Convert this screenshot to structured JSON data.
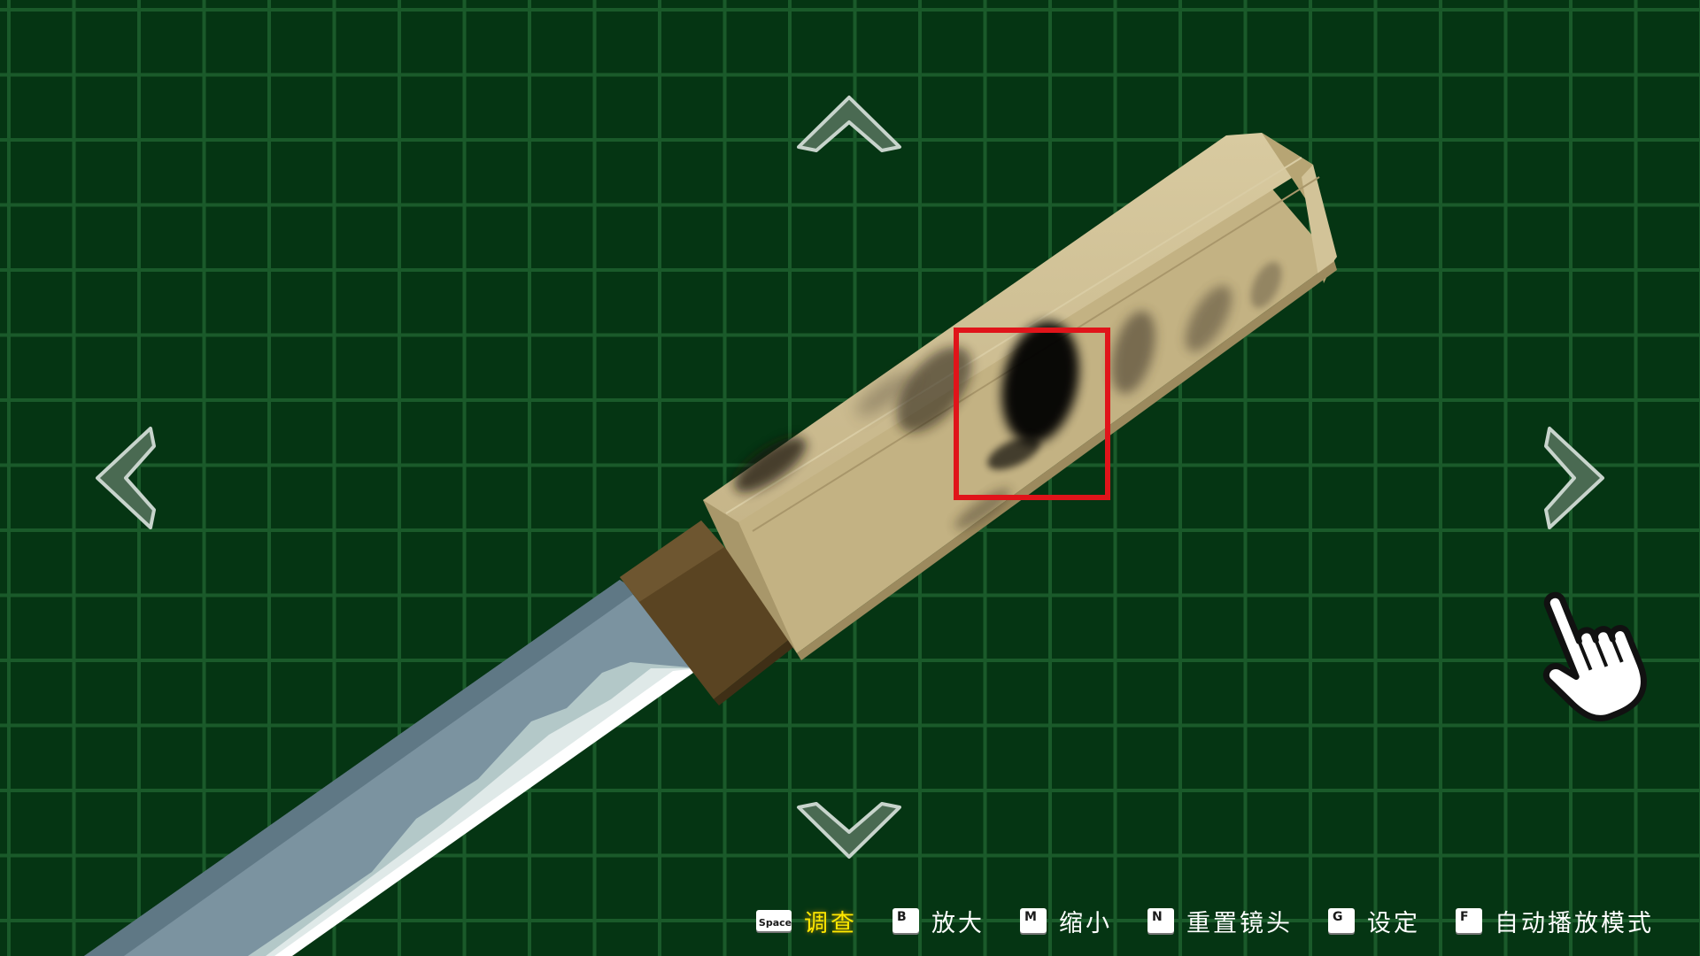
{
  "controls": [
    {
      "key": "Space",
      "label": "调查",
      "active": true
    },
    {
      "key": "B",
      "label": "放大",
      "active": false
    },
    {
      "key": "M",
      "label": "缩小",
      "active": false
    },
    {
      "key": "N",
      "label": "重置镜头",
      "active": false
    },
    {
      "key": "G",
      "label": "设定",
      "active": false
    },
    {
      "key": "F",
      "label": "自动播放模式",
      "active": false
    }
  ],
  "icons": {
    "up": "chevron-up-icon",
    "down": "chevron-down-icon",
    "left": "chevron-left-icon",
    "right": "chevron-right-icon",
    "cursor": "pointing-hand-icon"
  },
  "colors": {
    "background": "#053513",
    "grid": "#1a5a2a",
    "highlight_box": "#e0141a",
    "active_label": "#ffe800",
    "handle": "#c8b88a",
    "collar": "#5a4422",
    "blade": "#7b93a0"
  }
}
